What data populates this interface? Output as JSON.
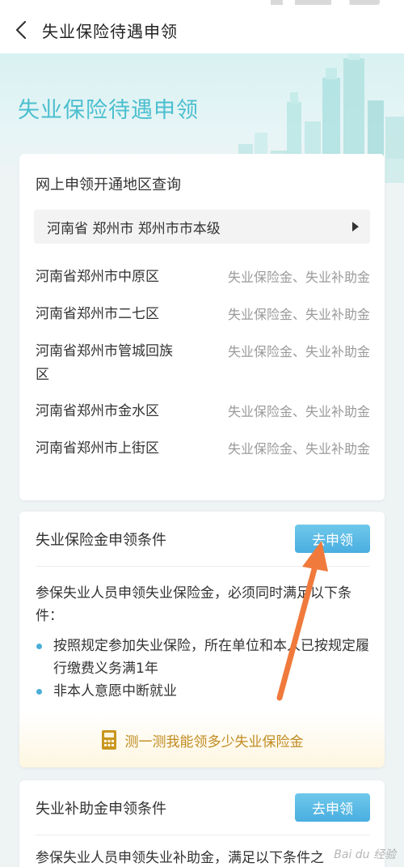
{
  "header": {
    "title": "失业保险待遇申领"
  },
  "banner": {
    "title": "失业保险待遇申领"
  },
  "region_query": {
    "title": "网上申领开通地区查询",
    "selected_region": "河南省 郑州市 郑州市市本级",
    "rows": [
      {
        "name": "河南省郑州市中原区",
        "benefit": "失业保险金、失业补助金"
      },
      {
        "name": "河南省郑州市二七区",
        "benefit": "失业保险金、失业补助金"
      },
      {
        "name": "河南省郑州市管城回族区",
        "benefit": "失业保险金、失业补助金"
      },
      {
        "name": "河南省郑州市金水区",
        "benefit": "失业保险金、失业补助金"
      },
      {
        "name": "河南省郑州市上街区",
        "benefit": "失业保险金、失业补助金"
      }
    ]
  },
  "insurance_conditions": {
    "title": "失业保险金申领条件",
    "apply_label": "去申领",
    "intro": "参保失业人员申领失业保险金，必须同时满足以下条件：",
    "bullets": [
      "按照规定参加失业保险，所在单位和本人已按规定履行缴费义务满1年",
      "非本人意愿中断就业"
    ],
    "calc_label": "测一测我能领多少失业保险金"
  },
  "subsidy_conditions": {
    "title": "失业补助金申领条件",
    "apply_label": "去申领",
    "intro": "参保失业人员申领失业补助金，满足以下条件之"
  },
  "colors": {
    "accent_blue": "#4aaed9",
    "banner_title": "#4bbfcf",
    "calc_text": "#c18b1f",
    "annotation_arrow": "#f07a3c"
  },
  "icons": {
    "back": "chevron-left-icon",
    "dropdown": "caret-right-icon",
    "calculator": "calculator-icon"
  }
}
